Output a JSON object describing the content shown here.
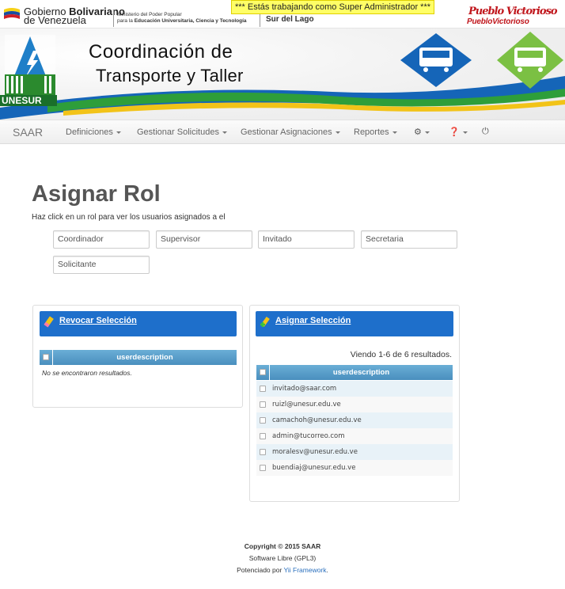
{
  "gov_header": {
    "gov_line1_prefix": "Gobierno",
    "gov_line1_bold": "Bolivariano",
    "gov_line2": "de Venezuela",
    "ministry_line1": "Ministerio del Poder Popular",
    "ministry_line2_prefix": "para la",
    "ministry_line2_bold": "Educación Universitaria, Ciencia y Tecnología",
    "region": "Sur del Lago",
    "admin_notice": "*** Estás trabajando como Super Administrador ***",
    "pv_script": "Pueblo Victorioso",
    "pv_logo_text": "PuebloVictorioso"
  },
  "banner": {
    "title_line1": "Coordinación de",
    "title_line2": "Transporte y Taller",
    "logo_text": "UNESUR"
  },
  "navbar": {
    "brand": "SAAR",
    "items": [
      {
        "label": "Definiciones"
      },
      {
        "label": "Gestionar Solicitudes"
      },
      {
        "label": "Gestionar Asignaciones"
      },
      {
        "label": "Reportes"
      }
    ],
    "icons": [
      "gear-icon",
      "help-icon",
      "power-icon"
    ]
  },
  "page": {
    "title": "Asignar Rol",
    "description": "Haz click en un rol para ver los usuarios asignados a el"
  },
  "roles": [
    "Coordinador",
    "Supervisor",
    "Invitado",
    "Secretaria",
    "Solicitante"
  ],
  "left_panel": {
    "header": "Revocar Selección",
    "column": "userdescription",
    "empty_text": "No se encontraron resultados."
  },
  "right_panel": {
    "header": "Asignar Selección",
    "summary": "Viendo 1-6 de 6 resultados.",
    "column": "userdescription",
    "rows": [
      "invitado@saar.com",
      "ruizl@unesur.edu.ve",
      "camachoh@unesur.edu.ve",
      "admin@tucorreo.com",
      "moralesv@unesur.edu.ve",
      "buendiaj@unesur.edu.ve"
    ]
  },
  "footer": {
    "copyright": "Copyright © 2015 SAAR",
    "license": "Software Libre (GPL3)",
    "powered_prefix": "Potenciado por",
    "powered_link": "Yii Framework",
    "powered_suffix": "."
  },
  "colors": {
    "panel_blue": "#1e6fcb",
    "grid_header": "#4a8fbe",
    "banner_green": "#2e9e3a",
    "banner_blue": "#1565b8"
  }
}
